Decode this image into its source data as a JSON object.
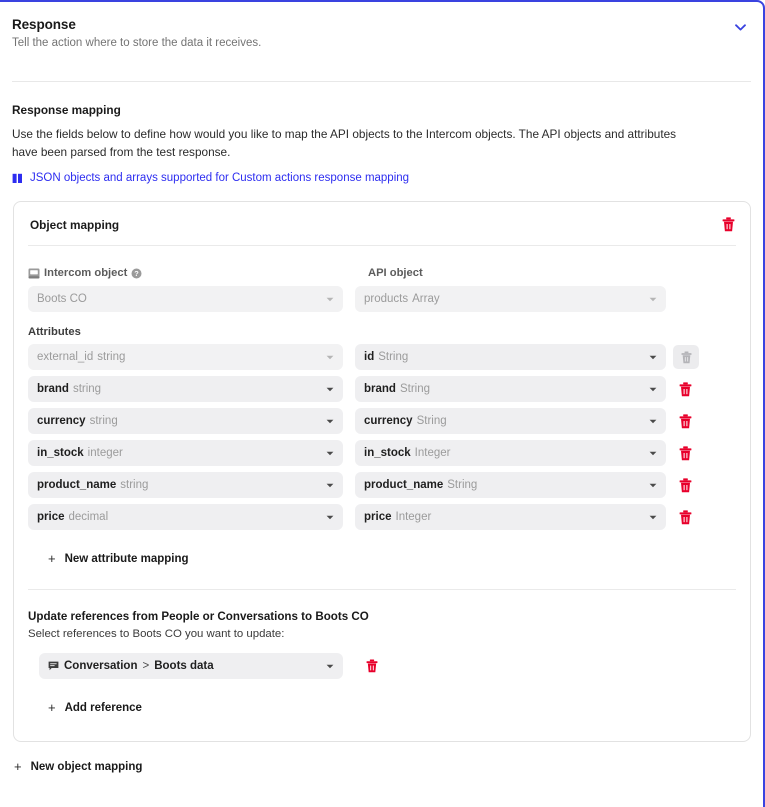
{
  "header": {
    "title": "Response",
    "subtitle": "Tell the action where to store the data it receives.",
    "collapse_icon": "chevron-down-icon",
    "accent_color": "#3a43e0"
  },
  "intro": {
    "title": "Response mapping",
    "body": "Use the fields below to define how would you like to map the API objects to the Intercom objects. The API objects and attributes have been parsed from the test response.",
    "link_text": "JSON objects and arrays supported for Custom actions response mapping",
    "link_icon": "book-icon",
    "link_color": "#2d2df0"
  },
  "object_mapping": {
    "title": "Object mapping",
    "delete_icon": "trash-icon",
    "delete_color": "#e8002b",
    "intercom_object": {
      "label": "Intercom object",
      "icon": "object-icon",
      "help_icon": "help-circle-icon",
      "value": "Boots CO"
    },
    "api_object": {
      "label": "API object",
      "value_key": "products",
      "value_type": "Array"
    },
    "attributes_label": "Attributes",
    "attributes": [
      {
        "intercom_key": "external_id",
        "intercom_type": "string",
        "intercom_disabled": true,
        "api_key": "id",
        "api_type": "String",
        "delete_enabled": false
      },
      {
        "intercom_key": "brand",
        "intercom_type": "string",
        "intercom_disabled": false,
        "api_key": "brand",
        "api_type": "String",
        "delete_enabled": true
      },
      {
        "intercom_key": "currency",
        "intercom_type": "string",
        "intercom_disabled": false,
        "api_key": "currency",
        "api_type": "String",
        "delete_enabled": true
      },
      {
        "intercom_key": "in_stock",
        "intercom_type": "integer",
        "intercom_disabled": false,
        "api_key": "in_stock",
        "api_type": "Integer",
        "delete_enabled": true
      },
      {
        "intercom_key": "product_name",
        "intercom_type": "string",
        "intercom_disabled": false,
        "api_key": "product_name",
        "api_type": "String",
        "delete_enabled": true
      },
      {
        "intercom_key": "price",
        "intercom_type": "decimal",
        "intercom_disabled": false,
        "api_key": "price",
        "api_type": "Integer",
        "delete_enabled": true
      }
    ],
    "new_attribute_mapping_label": "New attribute mapping",
    "references": {
      "title": "Update references from People or Conversations to Boots CO",
      "subtitle": "Select references to Boots CO you want to update:",
      "items": [
        {
          "icon": "conversation-icon",
          "source": "Conversation",
          "separator": ">",
          "target": "Boots data"
        }
      ],
      "add_label": "Add reference"
    }
  },
  "footer": {
    "new_object_mapping_label": "New object mapping"
  }
}
